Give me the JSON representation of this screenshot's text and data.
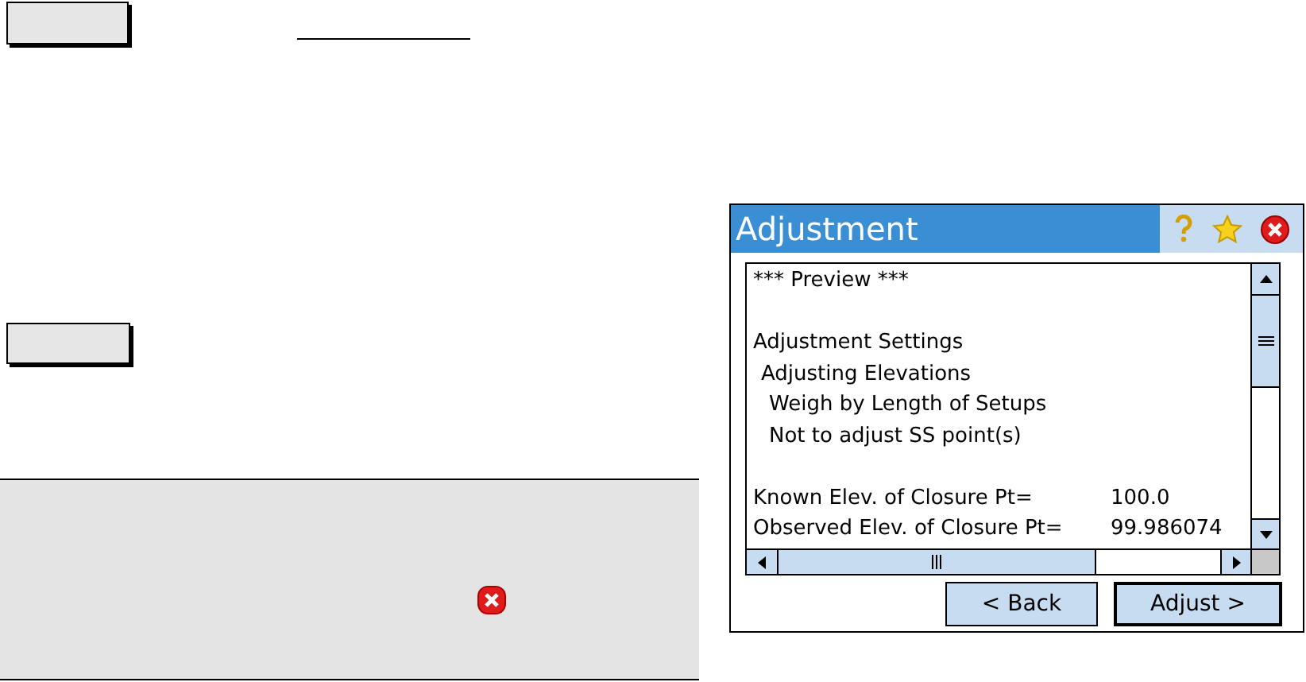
{
  "dialog": {
    "title": "Adjustment",
    "preview": {
      "heading": "*** Preview ***",
      "sections": [
        {
          "text": "Adjustment Settings",
          "children": [
            {
              "text": "Adjusting Elevations",
              "children": [
                {
                  "text": "Weigh by Length of Setups"
                },
                {
                  "text": "Not to adjust SS point(s)"
                }
              ]
            }
          ]
        }
      ],
      "readings": [
        {
          "label": "Known Elev. of Closure Pt=",
          "value": "100.0"
        },
        {
          "label": "Observed Elev. of Closure Pt=",
          "value": "99.986074"
        }
      ]
    },
    "buttons": [
      {
        "label": "< Back",
        "default": false
      },
      {
        "label": "Adjust >",
        "default": true
      }
    ]
  }
}
